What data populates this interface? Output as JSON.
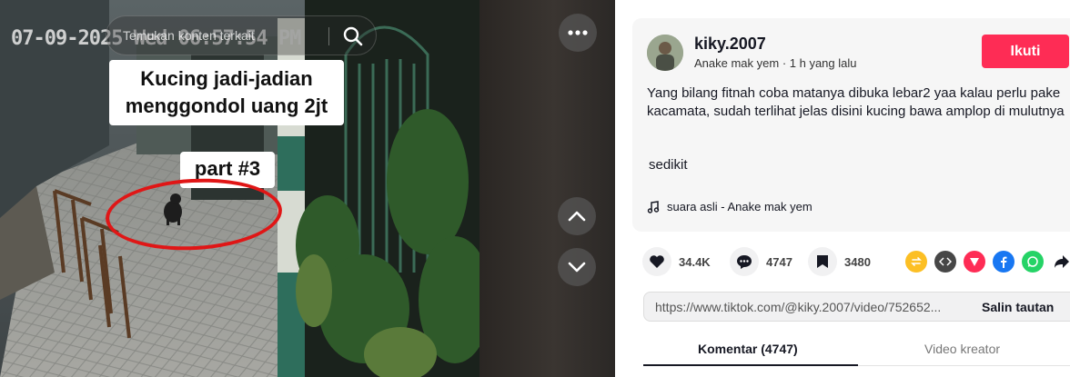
{
  "video": {
    "cctv_timestamp": "07-09-2025 Wed 06:57:54 PM",
    "search_placeholder": "Temukan konten terkait",
    "caption_main": "Kucing jadi-jadian menggondol uang 2jt",
    "caption_part": "part #3"
  },
  "post": {
    "username": "kiky.2007",
    "nickname": "Anake mak yem",
    "separator": " · ",
    "time_ago": "1 h yang lalu",
    "follow_label": "Ikuti",
    "description": "Yang bilang fitnah coba matanya dibuka lebar2 yaa kalau perlu pake kacamata, sudah terlihat jelas disini kucing bawa amplop di mulutnya",
    "extra_text": "sedikit",
    "music": "suara asli - Anake mak yem"
  },
  "stats": {
    "likes": "34.4K",
    "comments": "4747",
    "saves": "3480"
  },
  "share": {
    "icons": [
      "repost-icon",
      "embed-icon",
      "send-icon",
      "facebook-icon",
      "whatsapp-icon",
      "share-arrow-icon"
    ],
    "colors": {
      "repost": "#fcbf24",
      "embed": "#474747",
      "send": "#fe2c55",
      "facebook": "#1877f2",
      "whatsapp": "#25d366"
    }
  },
  "link": {
    "url": "https://www.tiktok.com/@kiky.2007/video/752652...",
    "copy_label": "Salin tautan"
  },
  "tabs": [
    {
      "label": "Komentar (4747)",
      "active": true
    },
    {
      "label": "Video kreator",
      "active": false
    }
  ],
  "colors": {
    "accent": "#fe2c55",
    "text": "#161823"
  }
}
